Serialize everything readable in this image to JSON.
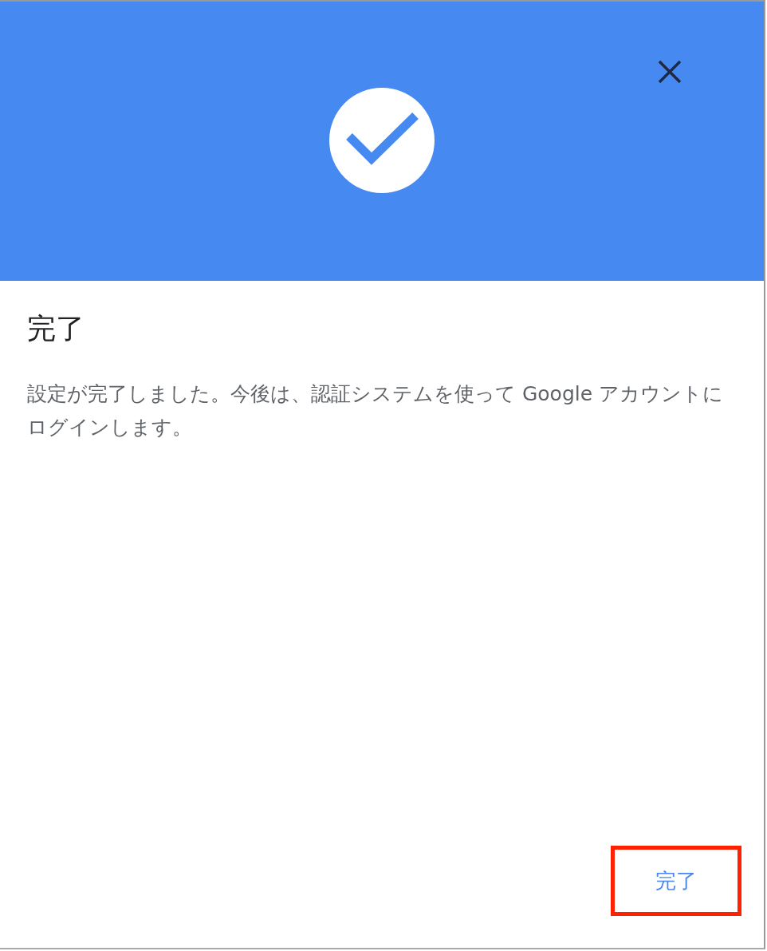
{
  "dialog": {
    "title": "完了",
    "message": "設定が完了しました。今後は、認証システムを使って Google アカウントにログインします。",
    "buttons": [
      {
        "label": "完了",
        "highlighted": true
      }
    ]
  }
}
